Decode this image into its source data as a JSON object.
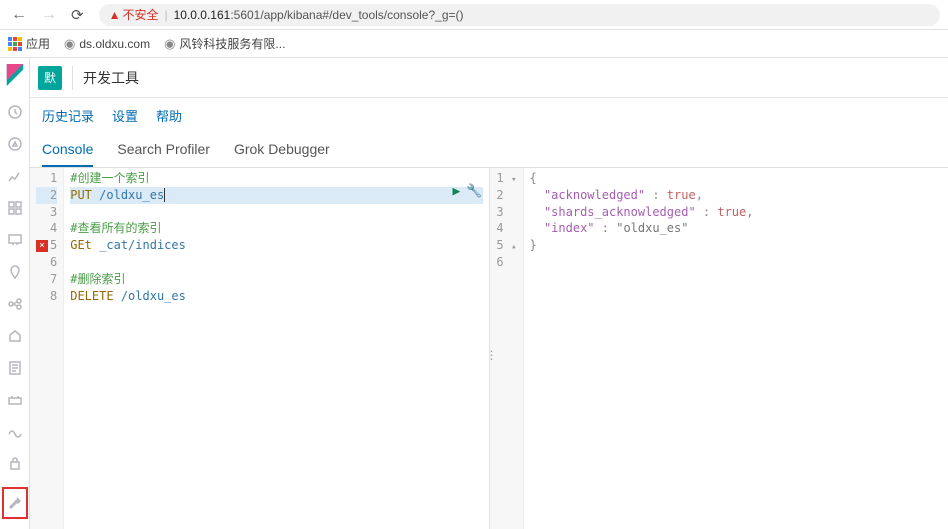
{
  "browser": {
    "not_secure": "不安全",
    "url_host": "10.0.0.161",
    "url_port_path": ":5601/app/kibana#/dev_tools/console?_g=()",
    "bookmarks": {
      "apps": "应用",
      "ds": "ds.oldxu.com",
      "fengling": "风铃科技服务有限..."
    }
  },
  "header": {
    "badge": "默",
    "title": "开发工具"
  },
  "links": {
    "history": "历史记录",
    "settings": "设置",
    "help": "帮助"
  },
  "tabs": {
    "console": "Console",
    "search_profiler": "Search Profiler",
    "grok": "Grok Debugger"
  },
  "request": {
    "lines": [
      {
        "n": 1,
        "type": "comment",
        "text": "#创建一个索引"
      },
      {
        "n": 2,
        "type": "cmd",
        "method": "PUT",
        "path": "/oldxu_es",
        "hl": true,
        "cursor": true
      },
      {
        "n": 3,
        "type": "blank",
        "text": ""
      },
      {
        "n": 4,
        "type": "comment",
        "text": "#查看所有的索引"
      },
      {
        "n": 5,
        "type": "cmd",
        "method": "GEt",
        "path": "_cat/indices",
        "error": true
      },
      {
        "n": 6,
        "type": "blank",
        "text": ""
      },
      {
        "n": 7,
        "type": "comment",
        "text": "#删除索引"
      },
      {
        "n": 8,
        "type": "cmd",
        "method": "DELETE",
        "path": "/oldxu_es"
      }
    ]
  },
  "response": {
    "lines": [
      {
        "n": 1,
        "fold": "open",
        "text": "{"
      },
      {
        "n": 2,
        "kv": true,
        "key": "acknowledged",
        "val": "true",
        "vtype": "bool",
        "comma": true
      },
      {
        "n": 3,
        "kv": true,
        "key": "shards_acknowledged",
        "val": "true",
        "vtype": "bool",
        "comma": true
      },
      {
        "n": 4,
        "kv": true,
        "key": "index",
        "val": "\"oldxu_es\"",
        "vtype": "str"
      },
      {
        "n": 5,
        "fold": "close",
        "text": "}"
      },
      {
        "n": 6,
        "text": ""
      }
    ]
  }
}
